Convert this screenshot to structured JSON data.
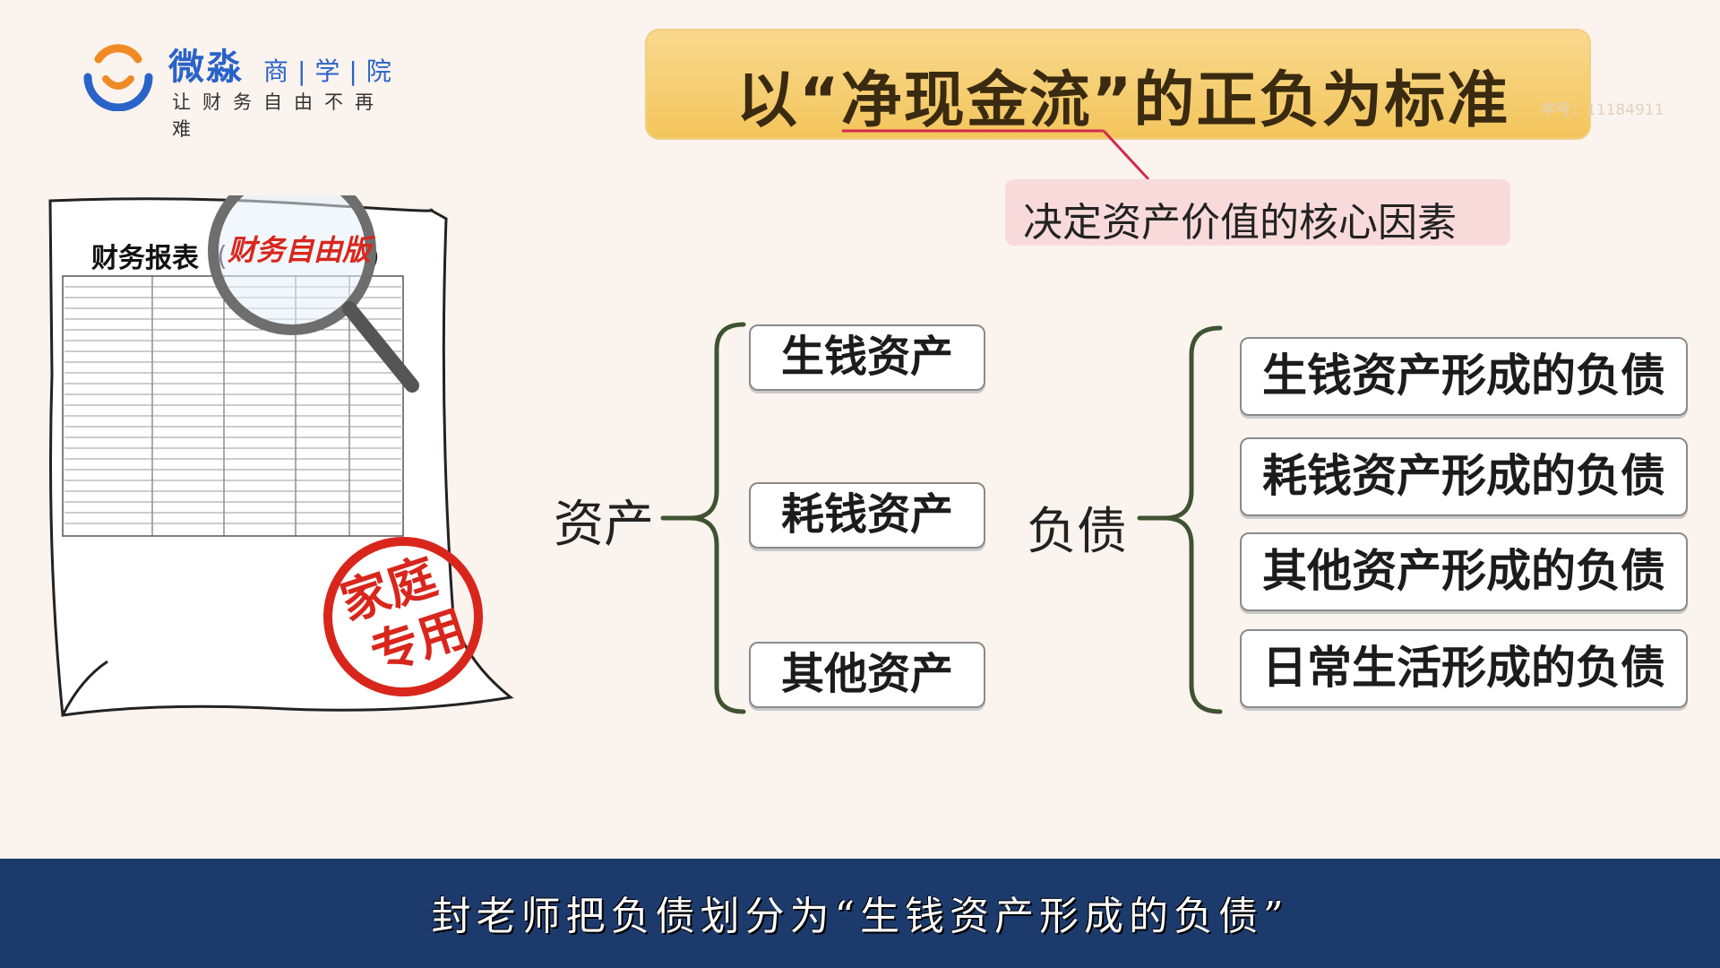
{
  "logo": {
    "brand": "微淼",
    "sub": "商|学|院",
    "slogan": "让财务自由不再难"
  },
  "title": {
    "prefix": "以",
    "quoted": "“净现金流”",
    "suffix": "的正负为标准"
  },
  "watermark": "学号：11184911",
  "subtitle": "决定资产价值的核心因素",
  "document": {
    "heading": "财务报表",
    "magnified": "财务自由版",
    "stamp_line1": "家庭",
    "stamp_line2": "专用"
  },
  "tree": {
    "assets_label": "资产",
    "assets": [
      "生钱资产",
      "耗钱资产",
      "其他资产"
    ],
    "liabilities_label": "负债",
    "liabilities": [
      "生钱资产形成的负债",
      "耗钱资产形成的负债",
      "其他资产形成的负债",
      "日常生活形成的负债"
    ]
  },
  "caption": "封老师把负债划分为“生钱资产形成的负债”",
  "colors": {
    "accent_blue": "#2a63c8",
    "logo_orange": "#f08a24",
    "title_bg": "#f5cb66",
    "subtitle_bg": "#f9dada",
    "bracket_green": "#3f5330",
    "stamp_red": "#d9261c",
    "caption_bg": "#1d3a6c"
  }
}
